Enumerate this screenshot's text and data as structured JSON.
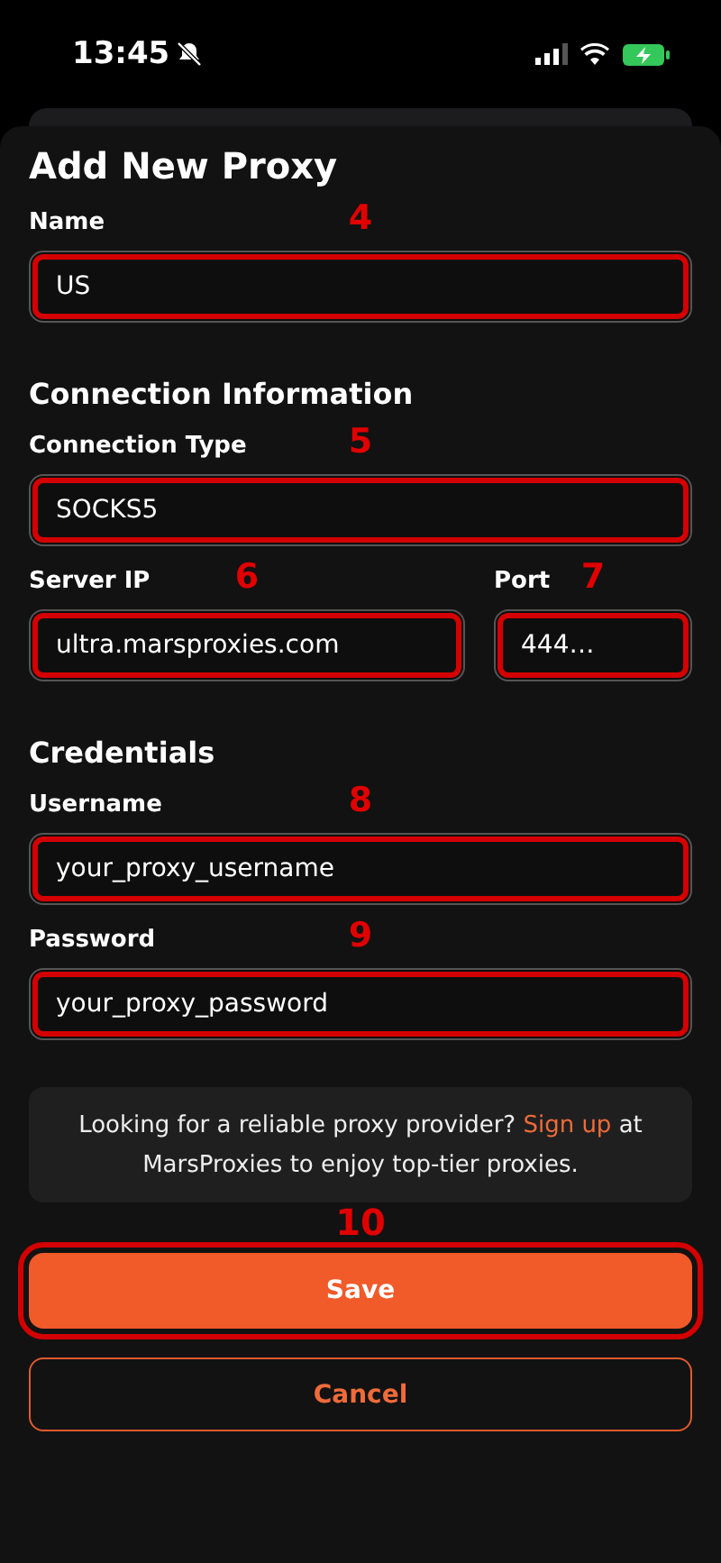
{
  "status_bar": {
    "time": "13:45"
  },
  "sheet": {
    "title": "Add New Proxy"
  },
  "sections": [
    {
      "kind": "fields",
      "rows": [
        [
          {
            "label": "Name",
            "value": "US",
            "callout": "4",
            "wide": true
          }
        ]
      ]
    },
    {
      "kind": "fields",
      "heading": "Connection Information",
      "rows": [
        [
          {
            "label": "Connection Type",
            "value": "SOCKS5",
            "callout": "5",
            "wide": true
          }
        ],
        [
          {
            "label": "Server IP",
            "value": "ultra.marsproxies.com",
            "callout": "6",
            "wide": true
          },
          {
            "label": "Port",
            "value": "444…",
            "callout": "7",
            "wide": false
          }
        ]
      ]
    },
    {
      "kind": "fields",
      "heading": "Credentials",
      "rows": [
        [
          {
            "label": "Username",
            "value": "your_proxy_username",
            "callout": "8",
            "wide": true
          }
        ],
        [
          {
            "label": "Password",
            "value": "your_proxy_password",
            "callout": "9",
            "wide": true
          }
        ]
      ]
    }
  ],
  "notice": {
    "before": "Looking for a reliable proxy provider?",
    "link": "Sign up",
    "after": "at MarsProxies to enjoy top-tier proxies."
  },
  "save_button": {
    "label": "Save",
    "callout": "10"
  },
  "cancel_button": {
    "label": "Cancel"
  }
}
